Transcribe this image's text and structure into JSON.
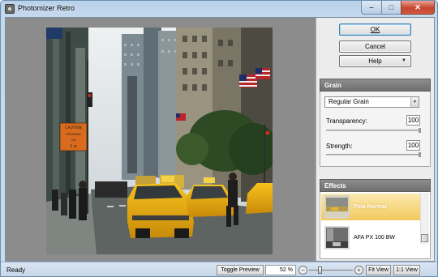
{
  "window": {
    "title": "Photomizer Retro",
    "min_symbol": "–",
    "max_symbol": "□",
    "close_symbol": "✕"
  },
  "buttons": {
    "ok": "OK",
    "cancel": "Cancel",
    "help": "Help"
  },
  "grain": {
    "header": "Grain",
    "type": "Regular Grain",
    "transparency_label": "Transparency:",
    "transparency_value": "100",
    "strength_label": "Strength:",
    "strength_value": "100"
  },
  "effects": {
    "header": "Effects",
    "items": [
      {
        "label": "Pola Normal"
      },
      {
        "label": "AFA PX 100 BW"
      }
    ]
  },
  "statusbar": {
    "status": "Ready",
    "toggle_preview": "Toggle Preview",
    "zoom": "52 %",
    "minus": "−",
    "plus": "+",
    "fit_view": "Fit View",
    "one_to_one": "1:1 View"
  },
  "photo_signs": {
    "caution": "CAUTION",
    "crossing": "CROSSING",
    "line_3": "ON",
    "line_4": "5 st"
  }
}
